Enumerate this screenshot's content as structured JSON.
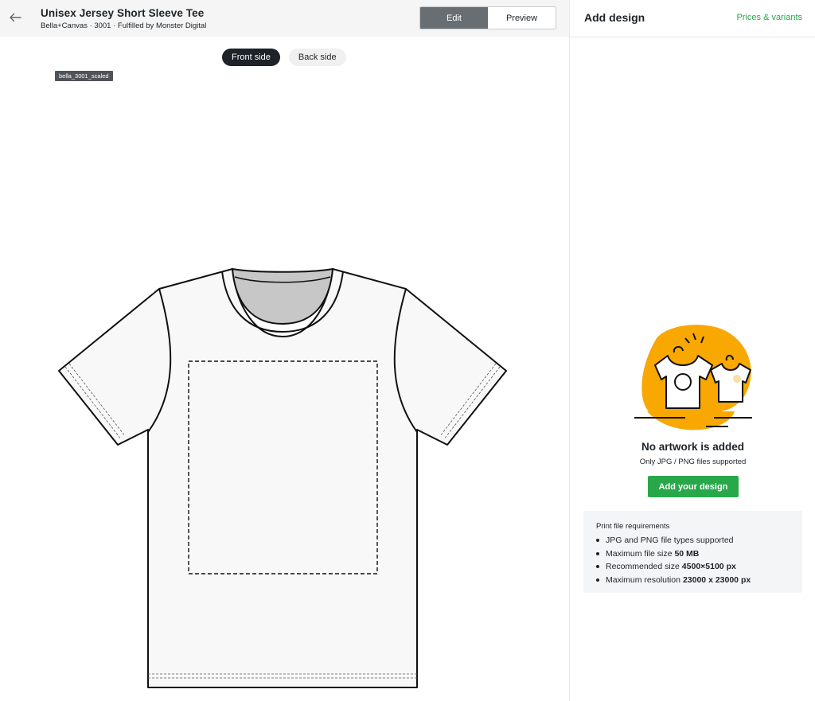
{
  "header": {
    "back_icon": "arrow-left-icon",
    "title": "Unisex Jersey Short Sleeve Tee",
    "subtitle": "Bella+Canvas · 3001 · Fulfilled by Monster Digital",
    "modes": [
      {
        "label": "Edit",
        "active": true
      },
      {
        "label": "Preview",
        "active": false
      }
    ]
  },
  "canvas": {
    "sides": [
      {
        "label": "Front side",
        "active": true
      },
      {
        "label": "Back side",
        "active": false
      }
    ],
    "image_label": "bella_3001_scaled",
    "garment_icon": "t-shirt-mockup-icon",
    "print_area_icon": "print-area-dashed-icon"
  },
  "panel": {
    "title": "Add design",
    "prices_link": "Prices & variants",
    "empty_state": {
      "illustration": "t-shirts-on-hangers-icon",
      "title": "No artwork is added",
      "subtitle": "Only JPG / PNG files supported",
      "button": "Add your design"
    },
    "requirements": {
      "title": "Print file requirements",
      "items": [
        {
          "text": "JPG and PNG file types supported",
          "value": ""
        },
        {
          "text": "Maximum file size",
          "value": "50 MB"
        },
        {
          "text": "Recommended size",
          "value": "4500×5100 px"
        },
        {
          "text": "Maximum resolution",
          "value": "23000 x 23000 px"
        }
      ]
    }
  },
  "colors": {
    "accent_green": "#29a84a",
    "illustration_orange": "#f8a800",
    "dark": "#1d2328",
    "edit_active": "#686e72"
  }
}
